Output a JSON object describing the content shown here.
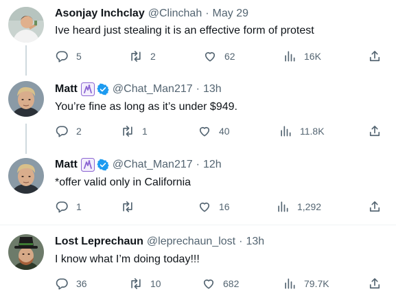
{
  "tweets": [
    {
      "name": "Asonjay Inchclay",
      "handle": "@Clinchah",
      "sep": "·",
      "time": "May 29",
      "text": "Ive heard just stealing it is an effective form of protest",
      "replies": "5",
      "retweets": "2",
      "likes": "62",
      "views": "16K",
      "verified": false,
      "badge": false
    },
    {
      "name": "Matt",
      "handle": "@Chat_Man217",
      "sep": "·",
      "time": "13h",
      "text": "You’re fine as long as it’s under $949.",
      "replies": "2",
      "retweets": "1",
      "likes": "40",
      "views": "11.8K",
      "verified": true,
      "badge": true
    },
    {
      "name": "Matt",
      "handle": "@Chat_Man217",
      "sep": "·",
      "time": "12h",
      "text": "*offer valid only in California",
      "replies": "1",
      "retweets": "",
      "likes": "16",
      "views": "1,292",
      "verified": true,
      "badge": true
    },
    {
      "name": "Lost Leprechaun",
      "handle": "@leprechaun_lost",
      "sep": "·",
      "time": "13h",
      "text": "I know what I’m doing today!!!",
      "replies": "36",
      "retweets": "10",
      "likes": "682",
      "views": "79.7K",
      "verified": false,
      "badge": false
    }
  ],
  "icons": {
    "reply": "reply-icon",
    "retweet": "retweet-icon",
    "like": "like-icon",
    "views": "views-icon",
    "share": "share-icon",
    "verified": "verified-icon",
    "badge": "affiliate-badge-icon"
  },
  "colors": {
    "text": "#0f1419",
    "secondary": "#536471",
    "verified": "#1d9bf0",
    "badge": "#8a63d2",
    "thread_line": "#cfd9de",
    "divider": "#eff3f4"
  }
}
